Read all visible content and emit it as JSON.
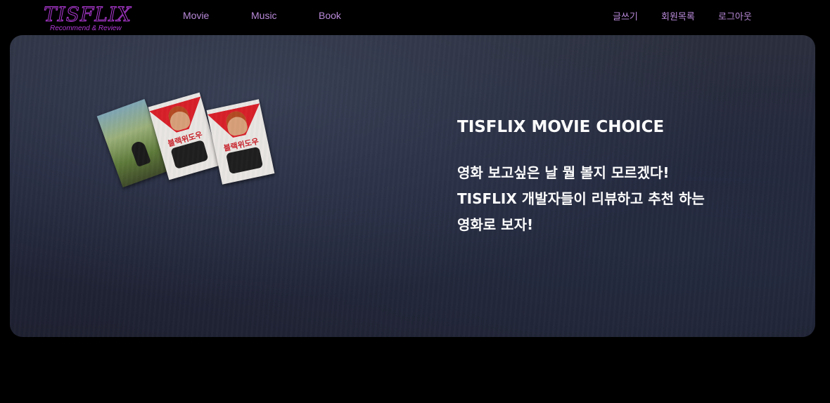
{
  "header": {
    "logo": {
      "main": "TISFLIX",
      "sub": "Recommend & Review"
    },
    "nav": [
      {
        "label": "Movie"
      },
      {
        "label": "Music"
      },
      {
        "label": "Book"
      }
    ],
    "actions": [
      {
        "label": "글쓰기"
      },
      {
        "label": "회원목록"
      },
      {
        "label": "로그아웃"
      }
    ]
  },
  "hero": {
    "title": "TISFLIX MOVIE CHOICE",
    "lines": [
      "영화 보고싶은 날 뭘 볼지 모르겠다!",
      "TISFLIX 개발자들이 리뷰하고 추천 하는",
      "영화로 보자!"
    ],
    "posters": [
      {
        "icon": "movie-poster-landscape"
      },
      {
        "icon": "movie-poster-black-widow",
        "title": "블랙위도우"
      },
      {
        "icon": "movie-poster-black-widow",
        "title": "블랙위도우"
      }
    ]
  },
  "colors": {
    "accent": "#b23ad8",
    "nav_text": "#b98ad9",
    "background": "#000000",
    "hero_bg": "#252a3a"
  }
}
